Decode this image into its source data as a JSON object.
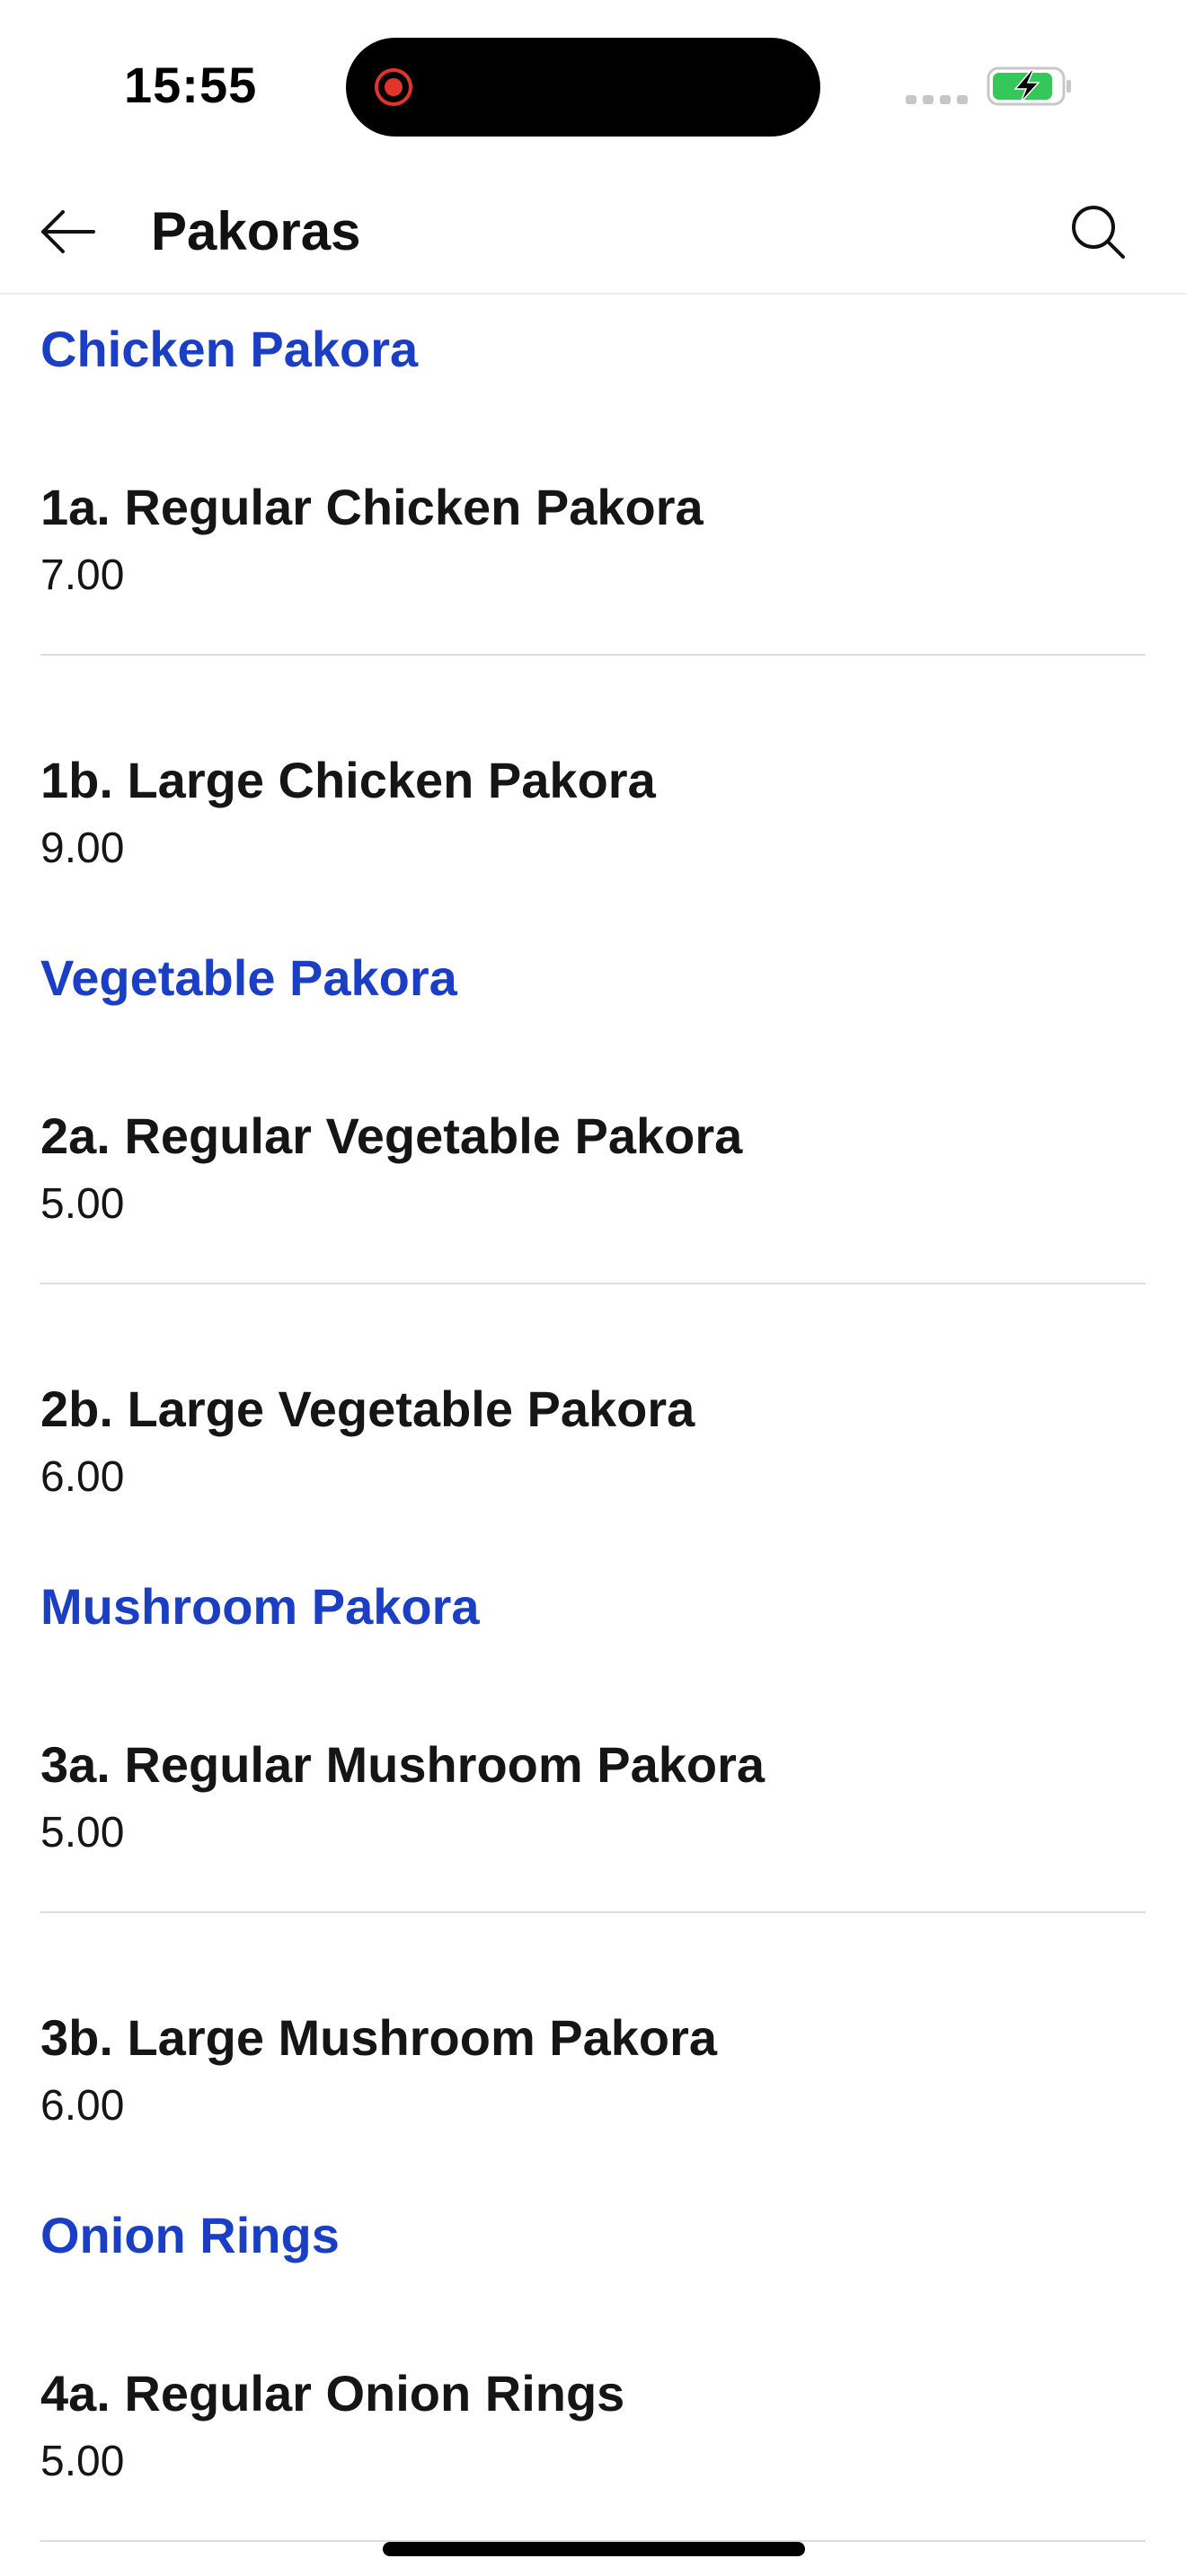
{
  "status_bar": {
    "time": "15:55",
    "icons": [
      "screen-record-icon",
      "cellular-signal-icon",
      "battery-charging-icon"
    ],
    "colors": {
      "record": "#e0352b",
      "battery_fill": "#34c759"
    }
  },
  "header": {
    "title": "Pakoras",
    "back_icon": "arrow-left-icon",
    "search_icon": "search-icon"
  },
  "colors": {
    "section_heading": "#1a3fc4",
    "text": "#151515",
    "divider": "#dcdcdc"
  },
  "sections": [
    {
      "heading": "Chicken Pakora",
      "items": [
        {
          "name": "1a. Regular Chicken Pakora",
          "price": "7.00"
        },
        {
          "name": "1b. Large Chicken Pakora",
          "price": "9.00"
        }
      ]
    },
    {
      "heading": "Vegetable Pakora",
      "items": [
        {
          "name": "2a. Regular Vegetable Pakora",
          "price": "5.00"
        },
        {
          "name": "2b. Large Vegetable Pakora",
          "price": "6.00"
        }
      ]
    },
    {
      "heading": "Mushroom Pakora",
      "items": [
        {
          "name": "3a. Regular Mushroom Pakora",
          "price": "5.00"
        },
        {
          "name": "3b. Large Mushroom Pakora",
          "price": "6.00"
        }
      ]
    },
    {
      "heading": "Onion Rings",
      "items": [
        {
          "name": "4a. Regular Onion Rings",
          "price": "5.00"
        }
      ]
    }
  ]
}
